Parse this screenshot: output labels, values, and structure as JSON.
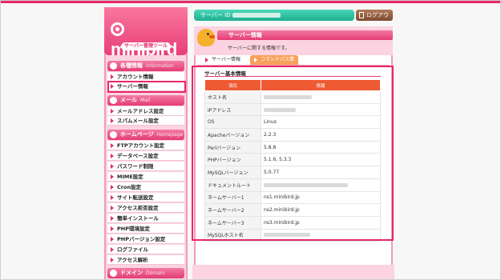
{
  "sidebar": {
    "logo": {
      "brand": "minibird",
      "tool": "サーバー管理ツール"
    },
    "sections": [
      {
        "title": "各種情報",
        "subtitle": "Information"
      },
      {
        "title": "メール",
        "subtitle": "Mail"
      },
      {
        "title": "ホームページ",
        "subtitle": "Homepage"
      },
      {
        "title": "ドメイン",
        "subtitle": "Domain"
      }
    ],
    "info_items": [
      "アカウント情報",
      "サーバー情報"
    ],
    "mail_items": [
      "メールアドレス設定",
      "スパムメール設定"
    ],
    "homepage_items": [
      "FTPアカウント設定",
      "データベース設定",
      "パスワード制限",
      "MIME設定",
      "Cron設定",
      "サイト転送設定",
      "アクセス拒否設定",
      "簡単インストール",
      "PHP環境設定",
      "PHPバージョン設定",
      "ログファイル",
      "アクセス解析"
    ]
  },
  "topbar": {
    "server_id_label": "サーバー ID",
    "logout_label": "ログアウト"
  },
  "main": {
    "title": "サーバー情報",
    "subtitle": "サーバーに関する情報です。",
    "tabs": [
      "サーバー情報",
      "コマンドパス情報"
    ],
    "section_title": "サーバー基本情報",
    "table": {
      "headers": [
        "項目",
        "情報"
      ],
      "rows": [
        {
          "key": "ホスト名",
          "value": ""
        },
        {
          "key": "IPアドレス",
          "value": ""
        },
        {
          "key": "OS",
          "value": "Linux"
        },
        {
          "key": "Apacheバージョン",
          "value": "2.2.3"
        },
        {
          "key": "Perlバージョン",
          "value": "5.8.8"
        },
        {
          "key": "PHPバージョン",
          "value": "5.1.6, 5.3.3"
        },
        {
          "key": "MySQLバージョン",
          "value": "5.0.77"
        },
        {
          "key": "ドキュメントルート",
          "value": ""
        },
        {
          "key": "ネームサーバー1",
          "value": "ns1.minibird.jp"
        },
        {
          "key": "ネームサーバー2",
          "value": "ns2.minibird.jp"
        },
        {
          "key": "ネームサーバー3",
          "value": "ns3.minibird.jp"
        },
        {
          "key": "MySQLホスト名",
          "value": ""
        }
      ]
    }
  },
  "colors": {
    "accent": "#e8286a",
    "panel_pink": "#fbd3e1",
    "teal": "#1fae91",
    "table_header": "#ee5a32"
  }
}
